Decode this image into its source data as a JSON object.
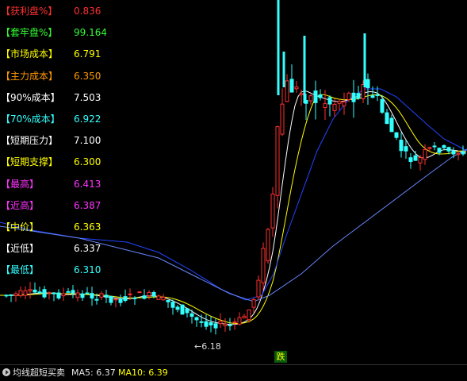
{
  "colors": {
    "up": "#ff3030",
    "down": "#33ffff",
    "ma_short": "#ffffff",
    "ma_mid": "#ffff00",
    "ma_long": "#2244ff",
    "ma_longest": "#6688ff"
  },
  "stats": [
    {
      "label": "【获利盘%】",
      "value": "0.836",
      "color": "#ff3030"
    },
    {
      "label": "【套牢盘%】",
      "value": "99.164",
      "color": "#33ff33"
    },
    {
      "label": "【市场成本】",
      "value": "6.791",
      "color": "#ffff00"
    },
    {
      "label": "【主力成本】",
      "value": "6.350",
      "color": "#ff9900"
    },
    {
      "label": "【90%成本】",
      "value": "7.503",
      "color": "#ffffff"
    },
    {
      "label": "【70%成本】",
      "value": "6.922",
      "color": "#33ffff"
    },
    {
      "label": "【短期压力】",
      "value": "7.100",
      "color": "#ffffff"
    },
    {
      "label": "【短期支撑】",
      "value": "6.300",
      "color": "#ffff00"
    },
    {
      "label": "【最高】",
      "value": "6.413",
      "color": "#ff33ff"
    },
    {
      "label": "【近高】",
      "value": "6.387",
      "color": "#ff33ff"
    },
    {
      "label": "【中价】",
      "value": "6.363",
      "color": "#ffff00"
    },
    {
      "label": "【近低】",
      "value": "6.337",
      "color": "#ffffff"
    },
    {
      "label": "【最低】",
      "value": "6.310",
      "color": "#33ffff"
    }
  ],
  "low_marker": "←6.18",
  "signal_badge": "跌",
  "footer": {
    "title": "均线超短买卖",
    "ma5": "MA5: 6.37",
    "ma10": "MA10: 6.39"
  }
}
